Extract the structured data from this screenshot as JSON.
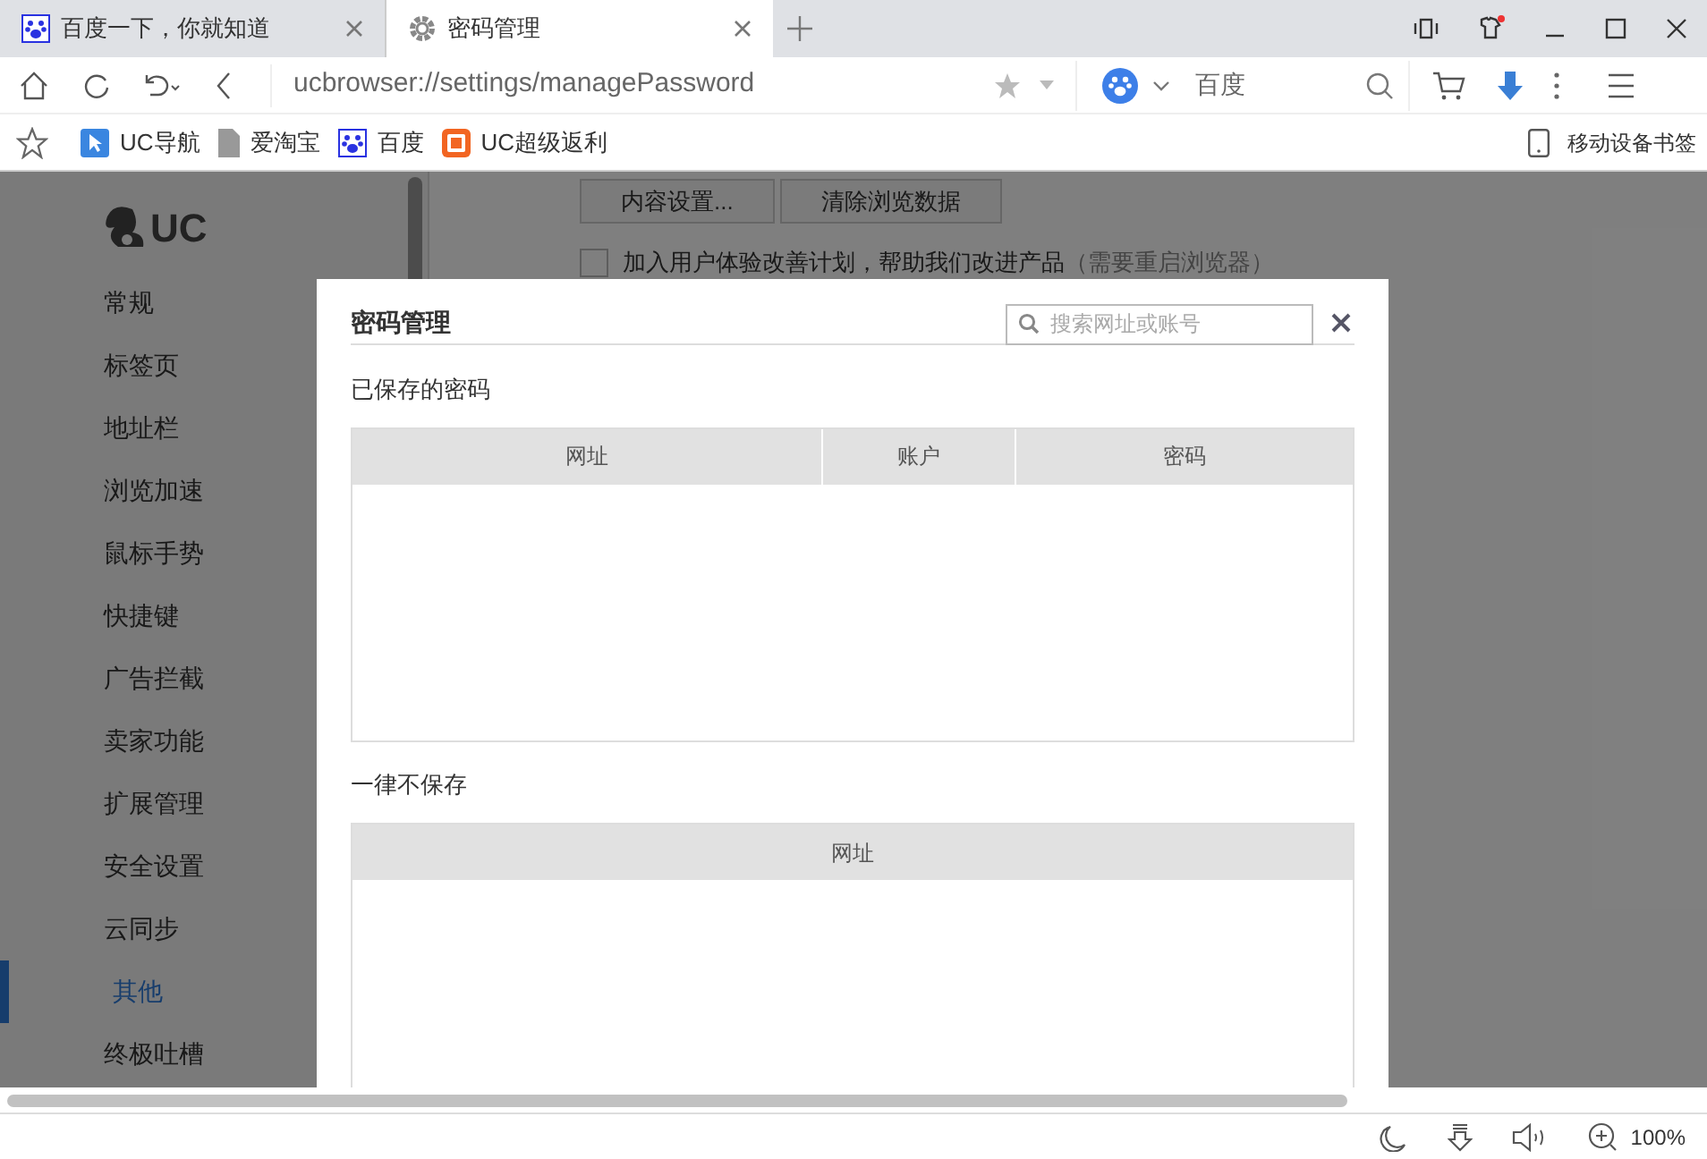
{
  "tabs": [
    {
      "label": "百度一下，你就知道",
      "kind": "paw",
      "selected": false
    },
    {
      "label": "密码管理",
      "kind": "gear",
      "selected": true
    }
  ],
  "toolbar": {
    "address": "ucbrowser://settings/managePassword",
    "search_engine": "百度"
  },
  "bookmarks": {
    "items": [
      {
        "label": "UC导航",
        "kind": "cursor"
      },
      {
        "label": "爱淘宝",
        "kind": "page"
      },
      {
        "label": "百度",
        "kind": "paw"
      },
      {
        "label": "UC超级返利",
        "kind": "tao"
      }
    ],
    "mobile": "移动设备书签"
  },
  "settings": {
    "logo": "UC",
    "sidebar": [
      {
        "label": "常规",
        "selected": false
      },
      {
        "label": "标签页",
        "selected": false
      },
      {
        "label": "地址栏",
        "selected": false
      },
      {
        "label": "浏览加速",
        "selected": false
      },
      {
        "label": "鼠标手势",
        "selected": false
      },
      {
        "label": "快捷键",
        "selected": false
      },
      {
        "label": "广告拦截",
        "selected": false
      },
      {
        "label": "卖家功能",
        "selected": false
      },
      {
        "label": "扩展管理",
        "selected": false
      },
      {
        "label": "安全设置",
        "selected": false
      },
      {
        "label": "云同步",
        "selected": false
      },
      {
        "label": "其他",
        "selected": true
      },
      {
        "label": "终极吐槽",
        "selected": false
      }
    ],
    "buttons": [
      "内容设置...",
      "清除浏览数据"
    ],
    "checkbox": {
      "label": "加入用户体验改善计划，帮助我们改进产品",
      "note": "（需要重启浏览器）",
      "checked": false
    }
  },
  "dialog": {
    "title": "密码管理",
    "search_placeholder": "搜索网址或账号",
    "saved": {
      "title": "已保存的密码",
      "columns": [
        "网址",
        "账户",
        "密码"
      ]
    },
    "never": {
      "title": "一律不保存",
      "columns": [
        "网址"
      ]
    }
  },
  "status_bar": {
    "zoom": "100%"
  }
}
